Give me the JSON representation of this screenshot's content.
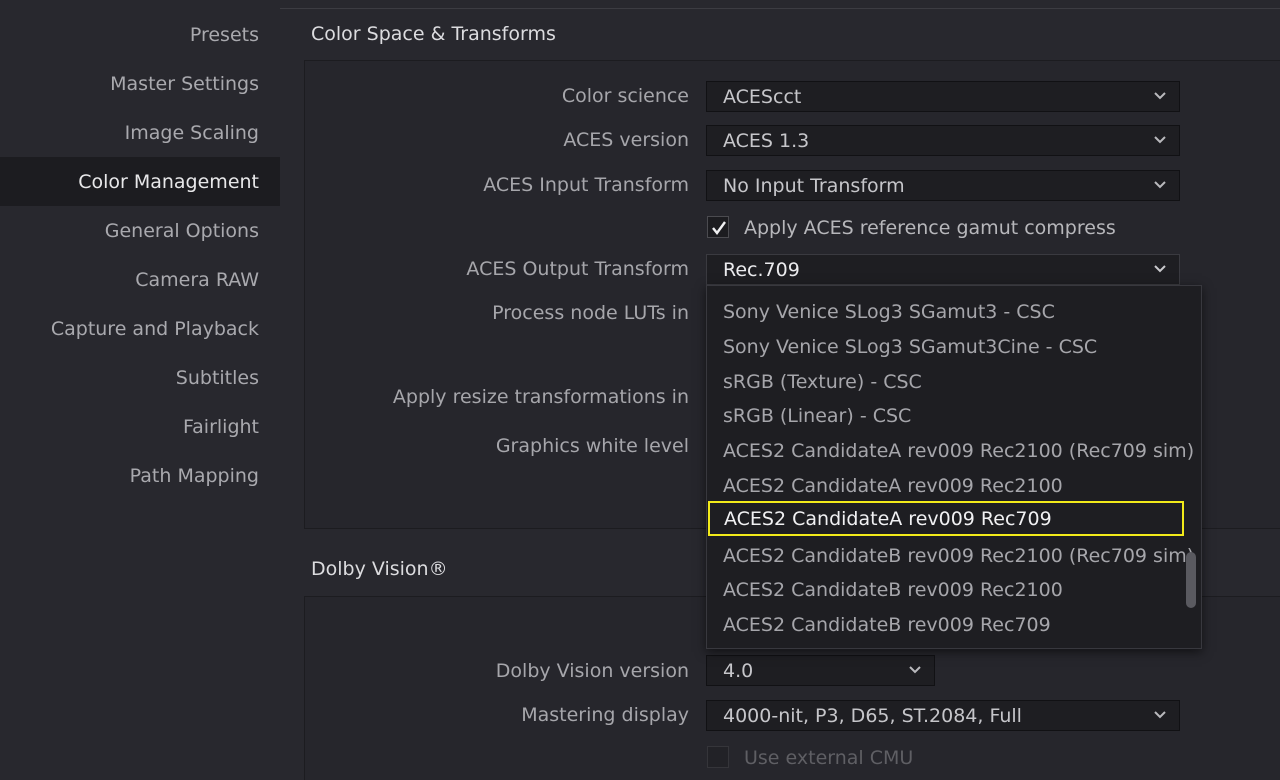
{
  "sidebar": {
    "items": [
      {
        "label": "Presets"
      },
      {
        "label": "Master Settings"
      },
      {
        "label": "Image Scaling"
      },
      {
        "label": "Color Management"
      },
      {
        "label": "General Options"
      },
      {
        "label": "Camera RAW"
      },
      {
        "label": "Capture and Playback"
      },
      {
        "label": "Subtitles"
      },
      {
        "label": "Fairlight"
      },
      {
        "label": "Path Mapping"
      }
    ],
    "active": "Color Management"
  },
  "color_space": {
    "title": "Color Space & Transforms",
    "color_science": {
      "label": "Color science",
      "value": "ACEScct"
    },
    "aces_version": {
      "label": "ACES version",
      "value": "ACES 1.3"
    },
    "input_transform": {
      "label": "ACES Input Transform",
      "value": "No Input Transform"
    },
    "gamut_compress": {
      "label": "Apply ACES reference gamut compress",
      "checked": true
    },
    "output_transform": {
      "label": "ACES Output Transform",
      "value": "Rec.709"
    },
    "process_luts": {
      "label": "Process node LUTs in"
    },
    "resize": {
      "label": "Apply resize transformations in"
    },
    "white_level": {
      "label": "Graphics white level"
    }
  },
  "dropdown": {
    "options": [
      "Sony Venice SLog3 SGamut3 - CSC",
      "Sony Venice SLog3 SGamut3Cine - CSC",
      "sRGB (Texture) - CSC",
      "sRGB (Linear) - CSC",
      "ACES2 CandidateA rev009 Rec2100 (Rec709 sim)",
      "ACES2 CandidateA rev009 Rec2100",
      "ACES2 CandidateA rev009 Rec709",
      "ACES2 CandidateB rev009 Rec2100 (Rec709 sim)",
      "ACES2 CandidateB rev009 Rec2100",
      "ACES2 CandidateB rev009 Rec709"
    ],
    "highlighted": "ACES2 CandidateA rev009 Rec709"
  },
  "dolby": {
    "title": "Dolby Vision®",
    "version": {
      "label": "Dolby Vision version",
      "value": "4.0"
    },
    "mastering": {
      "label": "Mastering display",
      "value": "4000-nit, P3, D65, ST.2084, Full"
    },
    "external_cmu": {
      "label": "Use external CMU",
      "checked": false
    }
  },
  "colors": {
    "background": "#28282e",
    "sidebar_active": "#1c1c20",
    "highlight_border": "#f2ea1a"
  }
}
